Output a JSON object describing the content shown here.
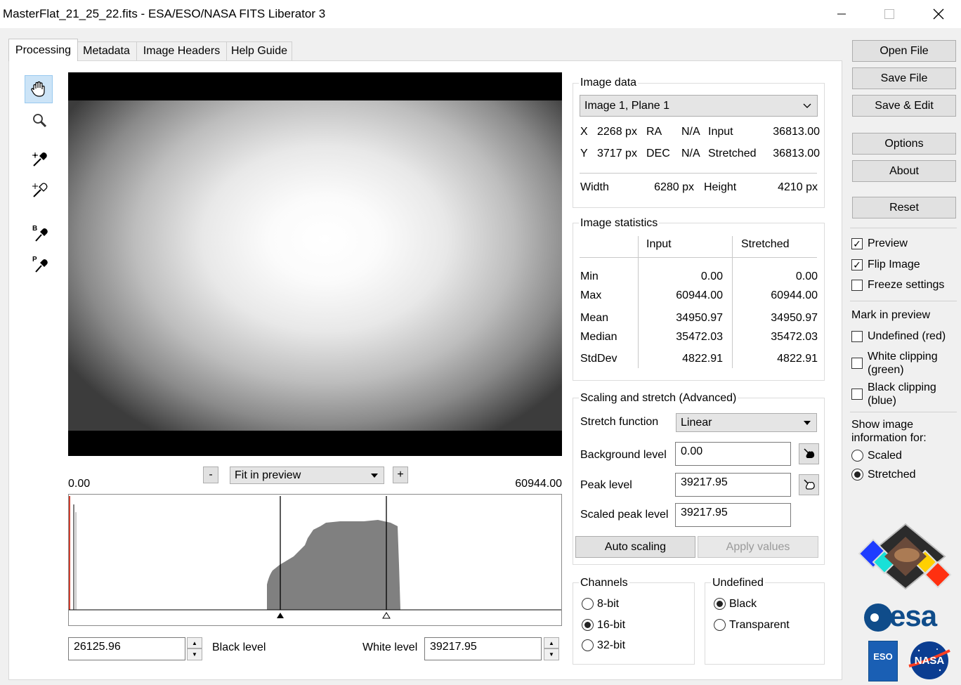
{
  "window": {
    "title": "MasterFlat_21_25_22.fits - ESA/ESO/NASA FITS Liberator 3"
  },
  "tabs": [
    {
      "label": "Processing"
    },
    {
      "label": "Metadata"
    },
    {
      "label": "Image Headers"
    },
    {
      "label": "Help Guide"
    }
  ],
  "tools": {
    "picker_b_letter": "B",
    "picker_p_letter": "P"
  },
  "zoom": {
    "minus": "-",
    "plus": "+",
    "selected": "Fit in preview"
  },
  "histogram": {
    "min_label": "0.00",
    "max_label": "60944.00",
    "black_level_value": "26125.96",
    "black_level_label": "Black level",
    "white_level_label": "White level",
    "white_level_value": "39217.95"
  },
  "image_data": {
    "title": "Image data",
    "plane_select": "Image 1, Plane 1",
    "x_label": "X",
    "x_value": "2268 px",
    "ra_label": "RA",
    "ra_value": "N/A",
    "input_label": "Input",
    "input_value": "36813.00",
    "y_label": "Y",
    "y_value": "3717 px",
    "dec_label": "DEC",
    "dec_value": "N/A",
    "stretched_label": "Stretched",
    "stretched_value": "36813.00",
    "width_label": "Width",
    "width_value": "6280 px",
    "height_label": "Height",
    "height_value": "4210 px"
  },
  "image_statistics": {
    "title": "Image statistics",
    "col_input": "Input",
    "col_stretched": "Stretched",
    "rows": [
      {
        "label": "Min",
        "input": "0.00",
        "stretched": "0.00"
      },
      {
        "label": "Max",
        "input": "60944.00",
        "stretched": "60944.00"
      },
      {
        "label": "Mean",
        "input": "34950.97",
        "stretched": "34950.97"
      },
      {
        "label": "Median",
        "input": "35472.03",
        "stretched": "35472.03"
      },
      {
        "label": "StdDev",
        "input": "4822.91",
        "stretched": "4822.91"
      }
    ]
  },
  "scaling": {
    "title": "Scaling and stretch (Advanced)",
    "stretch_label": "Stretch function",
    "stretch_value": "Linear",
    "background_label": "Background level",
    "background_value": "0.00",
    "peak_label": "Peak level",
    "peak_value": "39217.95",
    "scaled_peak_label": "Scaled peak level",
    "scaled_peak_value": "39217.95",
    "auto_scaling": "Auto scaling",
    "apply_values": "Apply values"
  },
  "channels": {
    "title": "Channels",
    "options": [
      "8-bit",
      "16-bit",
      "32-bit"
    ],
    "selected": "16-bit"
  },
  "undefined": {
    "title": "Undefined",
    "options": [
      "Black",
      "Transparent"
    ],
    "selected": "Black"
  },
  "sidebar": {
    "open_file": "Open File",
    "save_file": "Save File",
    "save_edit": "Save & Edit",
    "options": "Options",
    "about": "About",
    "reset": "Reset",
    "preview": "Preview",
    "flip_image": "Flip Image",
    "freeze_settings": "Freeze settings",
    "mark_title": "Mark in preview",
    "undefined_red": "Undefined (red)",
    "white_clip_1": "White clipping",
    "white_clip_2": "(green)",
    "black_clip_1": "Black clipping",
    "black_clip_2": "(blue)",
    "show_info_1": "Show image",
    "show_info_2": "information for:",
    "scaled": "Scaled",
    "stretched": "Stretched",
    "checked": {
      "preview": true,
      "flip_image": true,
      "freeze_settings": false,
      "undefined_red": false,
      "white_clipping": false,
      "black_clipping": false
    },
    "info_selected": "Stretched"
  },
  "logos": {
    "esa": "esa",
    "eso": "ESO",
    "nasa": "NASA"
  },
  "colors": {
    "accent_blue": "#0f4c8a",
    "histogram_fill": "#808080",
    "selected_tool": "#cce4f7"
  }
}
